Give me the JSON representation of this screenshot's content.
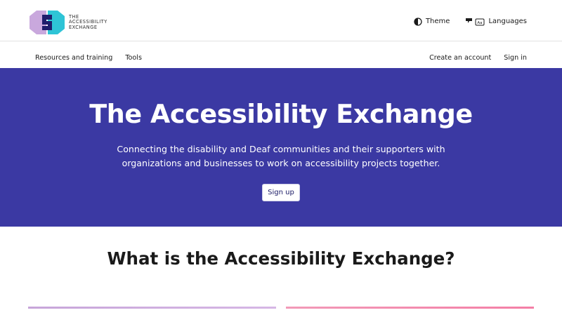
{
  "brand": {
    "logo_lines": [
      "THE",
      "ACCESSIBILITY",
      "EXCHANGE"
    ],
    "colors": {
      "primary": "#3b39a3",
      "logo_purple": "#c9a8dd",
      "logo_teal": "#2ec4d6",
      "logo_navy": "#1f1d6b"
    }
  },
  "header": {
    "theme_label": "Theme",
    "languages_label": "Languages"
  },
  "nav": {
    "left": [
      "Resources and training",
      "Tools"
    ],
    "right": [
      "Create an account",
      "Sign in"
    ]
  },
  "hero": {
    "title": "The Accessibility Exchange",
    "subtitle_line1": "Connecting the disability and Deaf communities and their supporters with",
    "subtitle_line2": "organizations and businesses to work on accessibility projects together.",
    "cta": "Sign up"
  },
  "section": {
    "title": "What is the Accessibility Exchange?"
  },
  "icons": {
    "theme": "half-circle-contrast-icon",
    "languages": "translate-icon"
  }
}
